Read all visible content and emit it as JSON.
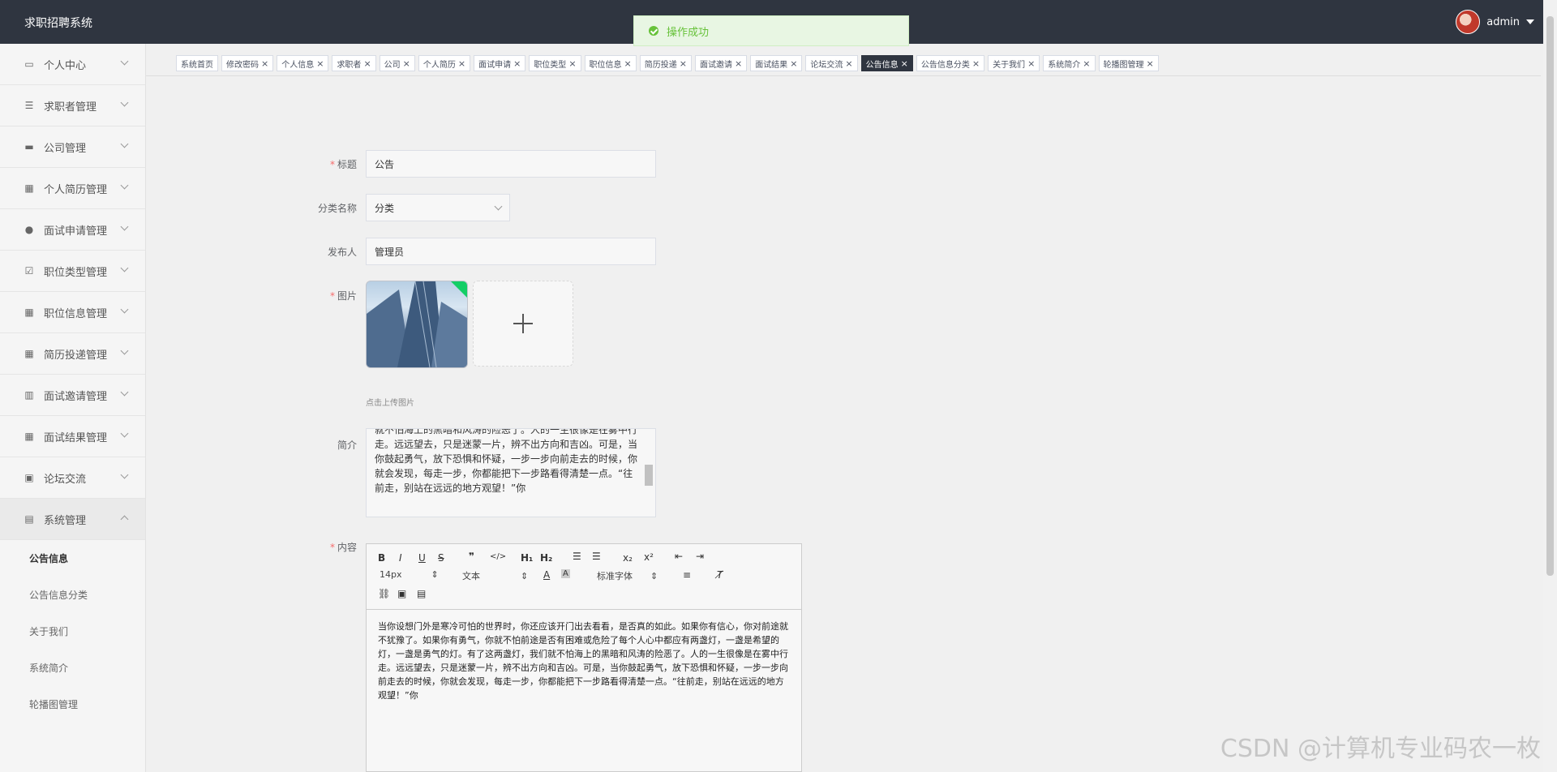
{
  "header": {
    "title": "求职招聘系统",
    "username": "admin"
  },
  "toast": {
    "message": "操作成功"
  },
  "sidebar": {
    "items": [
      {
        "label": "个人中心",
        "icon": "user-card-icon"
      },
      {
        "label": "求职者管理",
        "icon": "list-icon"
      },
      {
        "label": "公司管理",
        "icon": "chat-icon"
      },
      {
        "label": "个人简历管理",
        "icon": "grid-icon"
      },
      {
        "label": "面试申请管理",
        "icon": "person-icon"
      },
      {
        "label": "职位类型管理",
        "icon": "check-box-icon"
      },
      {
        "label": "职位信息管理",
        "icon": "grid-icon"
      },
      {
        "label": "简历投递管理",
        "icon": "grid-icon"
      },
      {
        "label": "面试邀请管理",
        "icon": "bar-chart-icon"
      },
      {
        "label": "面试结果管理",
        "icon": "grid-icon"
      },
      {
        "label": "论坛交流",
        "icon": "briefcase-icon"
      },
      {
        "label": "系统管理",
        "icon": "clipboard-icon"
      }
    ],
    "subitems": [
      "公告信息",
      "公告信息分类",
      "关于我们",
      "系统简介",
      "轮播图管理"
    ]
  },
  "tabs": [
    "系统首页",
    "修改密码",
    "个人信息",
    "求职者",
    "公司",
    "个人简历",
    "面试申请",
    "职位类型",
    "职位信息",
    "简历投递",
    "面试邀请",
    "面试结果",
    "论坛交流",
    "公告信息",
    "公告信息分类",
    "关于我们",
    "系统简介",
    "轮播图管理"
  ],
  "form": {
    "title_label": "标题",
    "title_value": "公告",
    "category_label": "分类名称",
    "category_value": "分类",
    "publisher_label": "发布人",
    "publisher_value": "管理员",
    "image_label": "图片",
    "upload_tip": "点击上传图片",
    "intro_label": "简介",
    "intro_text": "就不怕海上的黑暗和风涛的险恶了。人的一生很像是在雾中行走。远远望去，只是迷蒙一片，辨不出方向和吉凶。可是，当你鼓起勇气，放下恐惧和怀疑，一步一步向前走去的时候，你就会发现，每走一步，你都能把下一步路看得清楚一点。“往前走，别站在远远的地方观望！”你",
    "content_label": "内容"
  },
  "editor": {
    "font_size": "14px",
    "text_style": "文本",
    "font_family": "标准字体",
    "content": "当你设想门外是寒冷可怕的世界时，你还应该开门出去看看，是否真的如此。如果你有信心，你对前途就不犹豫了。如果你有勇气，你就不怕前途是否有困难或危险了每个人心中都应有两盏灯，一盏是希望的灯，一盏是勇气的灯。有了这两盏灯，我们就不怕海上的黑暗和风涛的险恶了。人的一生很像是在雾中行走。远远望去，只是迷蒙一片，辨不出方向和吉凶。可是，当你鼓起勇气，放下恐惧和怀疑，一步一步向前走去的时候，你就会发现，每走一步，你都能把下一步路看得清楚一点。“往前走，别站在远远的地方观望！”你"
  },
  "watermark": "CSDN @计算机专业码农一枚"
}
